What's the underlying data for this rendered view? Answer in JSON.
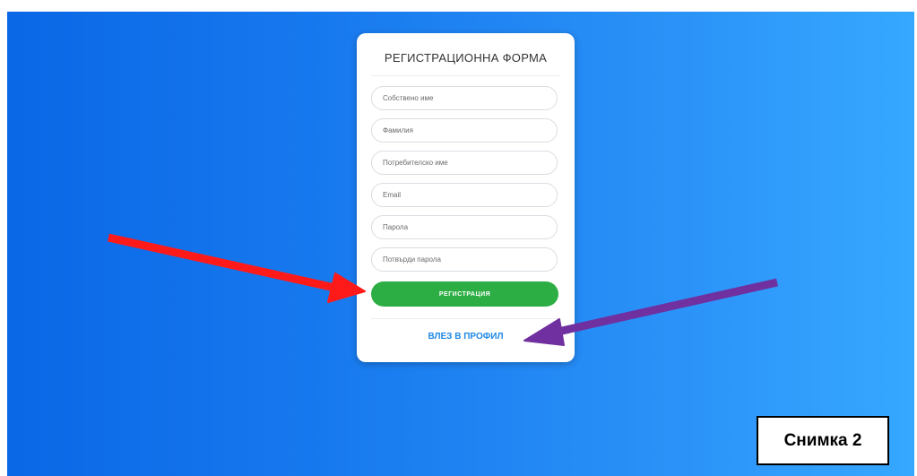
{
  "form": {
    "title": "РЕГИСТРАЦИОННА ФОРМА",
    "fields": [
      {
        "placeholder": "Собствено име",
        "value": ""
      },
      {
        "placeholder": "Фамилия",
        "value": ""
      },
      {
        "placeholder": "Потребителско име",
        "value": ""
      },
      {
        "placeholder": "Email",
        "value": ""
      },
      {
        "placeholder": "Парола",
        "value": ""
      },
      {
        "placeholder": "Потвърди парола",
        "value": ""
      }
    ],
    "register_label": "РЕГИСТРАЦИЯ",
    "login_label": "ВЛЕЗ В ПРОФИЛ"
  },
  "annotations": {
    "caption": "Снимка 2",
    "register_arrow_color": "#ff1a1a",
    "login_arrow_color": "#7030a0"
  },
  "colors": {
    "background_gradient_start": "#0a67e6",
    "background_gradient_end": "#36a8ff",
    "register_button": "#2cae44",
    "login_link": "#1e88e5"
  }
}
